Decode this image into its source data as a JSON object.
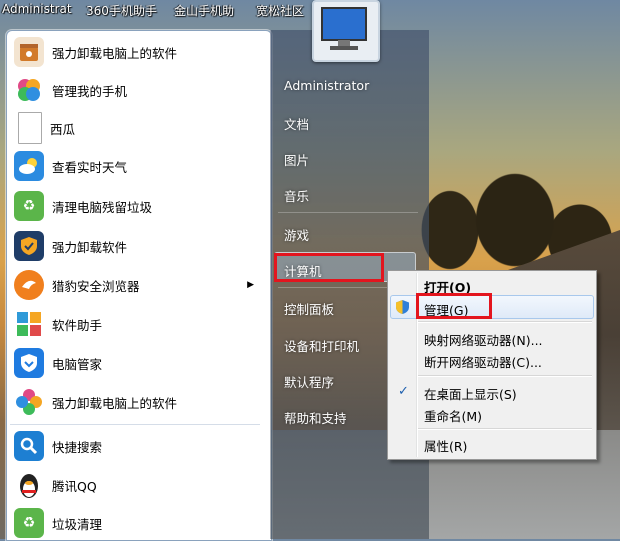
{
  "desktop": {
    "labels": [
      "Administrat",
      "360手机助手",
      "金山手机助",
      "宽松社区"
    ]
  },
  "left_menu": {
    "items": [
      {
        "label": "强力卸载电脑上的软件",
        "icon": "uninstall-box-icon",
        "color": "#d27a2a"
      },
      {
        "label": "管理我的手机",
        "icon": "phone-manager-icon",
        "color": "#e04a86"
      },
      {
        "label": "西瓜",
        "icon": "blank-document-icon",
        "color": "#ffffff"
      },
      {
        "label": "查看实时天气",
        "icon": "weather-cloud-icon",
        "color": "#2b8be0"
      },
      {
        "label": "清理电脑残留垃圾",
        "icon": "recycle-bin-icon",
        "color": "#5bb54a"
      },
      {
        "label": "强力卸载软件",
        "icon": "shield-uninstall-icon",
        "color": "#1f3d68"
      },
      {
        "label": "猎豹安全浏览器",
        "icon": "cheetah-browser-icon",
        "color": "#f07f1d"
      },
      {
        "label": "软件助手",
        "icon": "software-grid-icon",
        "color": "#2f9ad8"
      },
      {
        "label": "电脑管家",
        "icon": "pc-manager-shield-icon",
        "color": "#1f7be0"
      },
      {
        "label": "强力卸载电脑上的软件",
        "icon": "colorful-flower-icon",
        "color": "#8dc63f"
      },
      {
        "label": "快捷搜索",
        "icon": "search-icon",
        "color": "#1d7fd2"
      },
      {
        "label": "腾讯QQ",
        "icon": "qq-penguin-icon",
        "color": "#222222"
      },
      {
        "label": "垃圾清理",
        "icon": "trash-clean-icon",
        "color": "#5bb54a"
      }
    ]
  },
  "right_menu": {
    "items": [
      "Administrator",
      "文档",
      "图片",
      "音乐",
      "游戏",
      "计算机",
      "控制面板",
      "设备和打印机",
      "默认程序",
      "帮助和支持"
    ]
  },
  "context_menu": {
    "items": [
      {
        "label": "打开(O)",
        "bold": true
      },
      {
        "label": "管理(G)"
      },
      {
        "label": "映射网络驱动器(N)..."
      },
      {
        "label": "断开网络驱动器(C)..."
      },
      {
        "label": "在桌面上显示(S)"
      },
      {
        "label": "重命名(M)"
      },
      {
        "label": "属性(R)"
      }
    ]
  },
  "colors": {
    "highlight_red": "#e3151e",
    "check_blue": "#1d5fae"
  }
}
